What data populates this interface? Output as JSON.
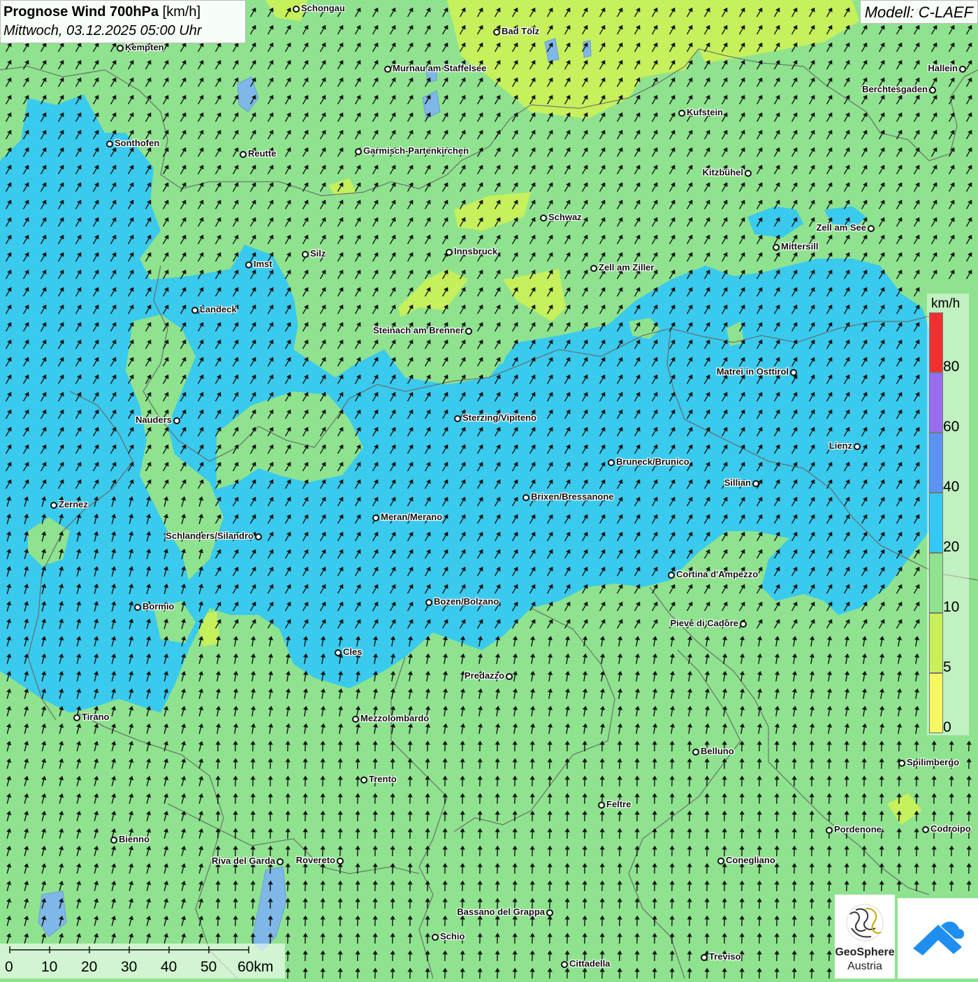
{
  "title": {
    "bold": "Prognose Wind 700hPa",
    "unit": "[km/h]",
    "datetime": "Mittwoch, 03.12.2025 05:00 Uhr"
  },
  "model": "Modell: C-LAEF",
  "legend": {
    "unit": "km/h",
    "classes": [
      {
        "label": "80",
        "color": "#f03030"
      },
      {
        "label": "60",
        "color": "#9a6cf0"
      },
      {
        "label": "40",
        "color": "#5b93f5"
      },
      {
        "label": "20",
        "color": "#33c8f5"
      },
      {
        "label": "10",
        "color": "#8fe38f"
      },
      {
        "label": "5",
        "color": "#c9f05a"
      },
      {
        "label": "0",
        "color": "#f7f760"
      }
    ]
  },
  "scale_bar": {
    "labels": [
      "0",
      "10",
      "20",
      "30",
      "40",
      "50",
      "60km"
    ]
  },
  "cities": [
    {
      "name": "Schongau"
    },
    {
      "name": "Bad Tölz"
    },
    {
      "name": "Kempten"
    },
    {
      "name": "Murnau am Staffelsee"
    },
    {
      "name": "Hallein"
    },
    {
      "name": "Berchtesgaden"
    },
    {
      "name": "Kufstein"
    },
    {
      "name": "Sonthofen"
    },
    {
      "name": "Reutte"
    },
    {
      "name": "Garmisch-Partenkirchen"
    },
    {
      "name": "Kitzbühel"
    },
    {
      "name": "Schwaz"
    },
    {
      "name": "Zell am See"
    },
    {
      "name": "Mittersill"
    },
    {
      "name": "Imst"
    },
    {
      "name": "Silz"
    },
    {
      "name": "Innsbruck"
    },
    {
      "name": "Zell am Ziller"
    },
    {
      "name": "Landeck"
    },
    {
      "name": "Steinach am Brenner"
    },
    {
      "name": "Matrei in Osttirol"
    },
    {
      "name": "Nauders"
    },
    {
      "name": "Sterzing/Vipiteno"
    },
    {
      "name": "Lienz"
    },
    {
      "name": "Bruneck/Brunico"
    },
    {
      "name": "Sillian"
    },
    {
      "name": "Zernez"
    },
    {
      "name": "Brixen/Bressanone"
    },
    {
      "name": "Meran/Merano"
    },
    {
      "name": "Schlanders/Silandro"
    },
    {
      "name": "Cortina d'Ampezzo"
    },
    {
      "name": "Bozen/Bolzano"
    },
    {
      "name": "Bormio"
    },
    {
      "name": "Pieve di Cadore"
    },
    {
      "name": "Cles"
    },
    {
      "name": "Predazzo"
    },
    {
      "name": "Tirano"
    },
    {
      "name": "Mezzolombardo"
    },
    {
      "name": "Belluno"
    },
    {
      "name": "Spilimbergo"
    },
    {
      "name": "Trento"
    },
    {
      "name": "Feltre"
    },
    {
      "name": "Pordenone"
    },
    {
      "name": "Codroipo"
    },
    {
      "name": "Bienno"
    },
    {
      "name": "Riva del Garda"
    },
    {
      "name": "Rovereto"
    },
    {
      "name": "Conegliano"
    },
    {
      "name": "Bassano del Grappa"
    },
    {
      "name": "Schio"
    },
    {
      "name": "Treviso"
    },
    {
      "name": "Cittadella"
    }
  ],
  "logo": {
    "line1": "GeoSphere",
    "line2": "Austria"
  },
  "icons": {
    "logo": "geosphere-logo-icon",
    "app": "wetter-app-icon"
  }
}
